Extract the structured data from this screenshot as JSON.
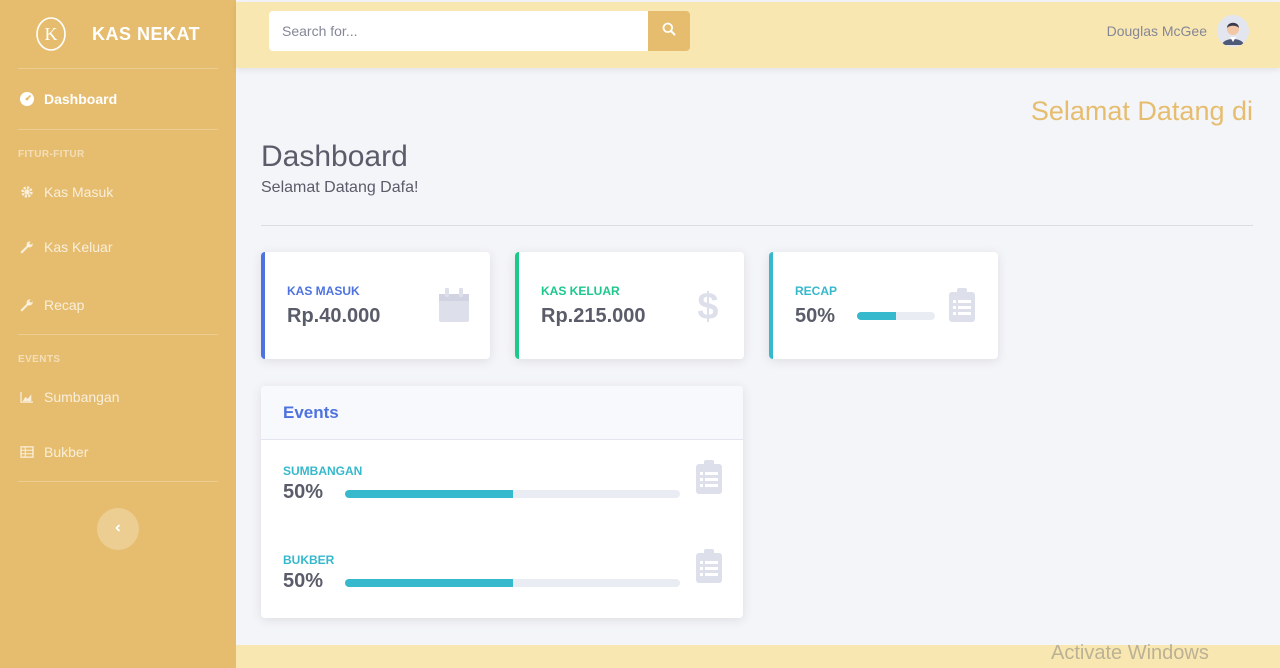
{
  "brand": {
    "name": "KAS NEKAT",
    "logo": "K"
  },
  "sidebar": {
    "dashboard_label": "Dashboard",
    "heading_features": "FITUR-FITUR",
    "items_features": [
      {
        "label": "Kas Masuk",
        "icon": "gear-icon"
      },
      {
        "label": "Kas Keluar",
        "icon": "wrench-icon"
      },
      {
        "label": "Recap",
        "icon": "wrench-icon"
      }
    ],
    "heading_events": "EVENTS",
    "items_events": [
      {
        "label": "Sumbangan",
        "icon": "area-chart-icon"
      },
      {
        "label": "Bukber",
        "icon": "table-icon"
      }
    ]
  },
  "topbar": {
    "search_placeholder": "Search for...",
    "user_name": "Douglas McGee"
  },
  "main": {
    "welcome_banner": "Selamat Datang di",
    "title": "Dashboard",
    "subtitle": "Selamat Datang Dafa!"
  },
  "cards": [
    {
      "label": "KAS MASUK",
      "value": "Rp.40.000",
      "color": "#4e73df",
      "icon": "calendar-icon"
    },
    {
      "label": "KAS KELUAR",
      "value": "Rp.215.000",
      "color": "#1cc88a",
      "icon": "dollar-icon"
    },
    {
      "label": "RECAP",
      "value": "50%",
      "progress": 0.5,
      "color": "#36b9cc",
      "icon": "clipboard-icon"
    }
  ],
  "events": {
    "title": "Events",
    "rows": [
      {
        "label": "SUMBANGAN",
        "value": "50%",
        "progress": 0.5
      },
      {
        "label": "BUKBER",
        "value": "50%",
        "progress": 0.5
      }
    ]
  },
  "colors": {
    "sidebar": "#e6bd6e",
    "topbar": "#f9e7b2",
    "accent": "#4e73df",
    "info": "#36b9cc",
    "success": "#1cc88a"
  },
  "watermark": "Activate Windows"
}
